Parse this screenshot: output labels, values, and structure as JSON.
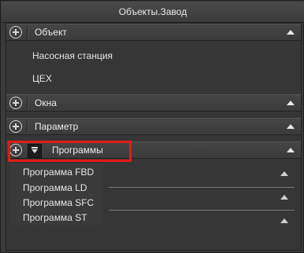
{
  "window": {
    "title": "Объекты.Завод"
  },
  "sections": [
    {
      "label": "Объект"
    },
    {
      "label": "Окна"
    },
    {
      "label": "Параметр"
    },
    {
      "label": "Программы"
    }
  ],
  "object_items": [
    "Насосная станция",
    "ЦЕХ"
  ],
  "programs_menu": [
    "Программа FBD",
    "Программа LD",
    "Программа SFC",
    "Программа ST"
  ],
  "colors": {
    "highlight": "#e21a1a",
    "background": "#363636"
  },
  "icons": [
    "plus-circle-icon",
    "collapse-triangle-icon",
    "expand-all-icon"
  ]
}
